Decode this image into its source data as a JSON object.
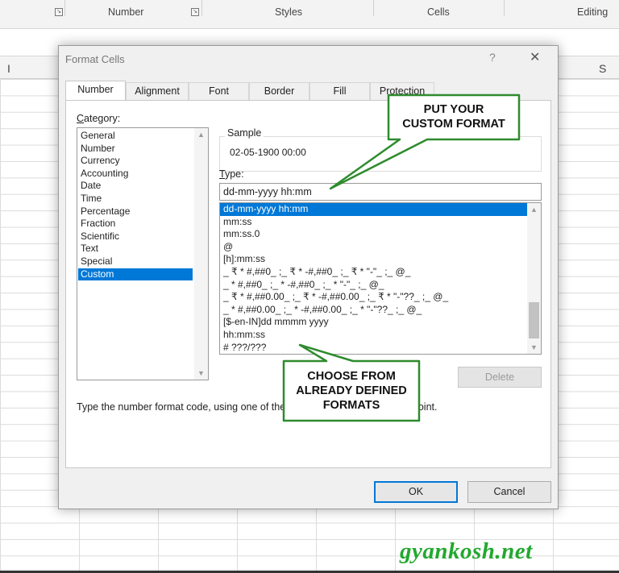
{
  "ribbon": {
    "groups": [
      "Number",
      "Styles",
      "Cells",
      "Editing"
    ]
  },
  "sheet": {
    "column_headers": [
      "I",
      "S"
    ]
  },
  "dialog": {
    "title": "Format Cells",
    "help_glyph": "?",
    "close_glyph": "✕",
    "tabs": [
      "Number",
      "Alignment",
      "Font",
      "Border",
      "Fill",
      "Protection"
    ],
    "active_tab": "Number",
    "category_label_first": "C",
    "category_label_rest": "ategory:",
    "categories": [
      "General",
      "Number",
      "Currency",
      "Accounting",
      "Date",
      "Time",
      "Percentage",
      "Fraction",
      "Scientific",
      "Text",
      "Special",
      "Custom"
    ],
    "selected_category": "Custom",
    "sample_label": "Sample",
    "sample_value": "02-05-1900 00:00",
    "type_label_first": "T",
    "type_label_rest": "ype:",
    "type_value": "dd-mm-yyyy hh:mm",
    "formats": [
      "dd-mm-yyyy hh:mm",
      "mm:ss",
      "mm:ss.0",
      "@",
      "[h]:mm:ss",
      "_ ₹ * #,##0_ ;_ ₹ * -#,##0_ ;_ ₹ * \"-\"_ ;_ @_",
      "_ * #,##0_ ;_ * -#,##0_ ;_ * \"-\"_ ;_ @_",
      "_ ₹ * #,##0.00_ ;_ ₹ * -#,##0.00_ ;_ ₹ * \"-\"??_ ;_ @_",
      "_ * #,##0.00_ ;_ * -#,##0.00_ ;_ * \"-\"??_ ;_ @_",
      "[$-en-IN]dd mmmm yyyy",
      "hh:mm:ss",
      "# ???/???"
    ],
    "selected_format": "dd-mm-yyyy hh:mm",
    "delete_label": "Delete",
    "help_text": "Type the number format code, using one of the existing codes as a starting point.",
    "ok_label": "OK",
    "cancel_label": "Cancel"
  },
  "callouts": {
    "top": [
      "PUT YOUR",
      "CUSTOM FORMAT"
    ],
    "bottom": [
      "CHOOSE FROM",
      "ALREADY DEFINED",
      "FORMATS"
    ],
    "border_color": "#2e8b2e"
  },
  "watermark": "gyankosh.net"
}
